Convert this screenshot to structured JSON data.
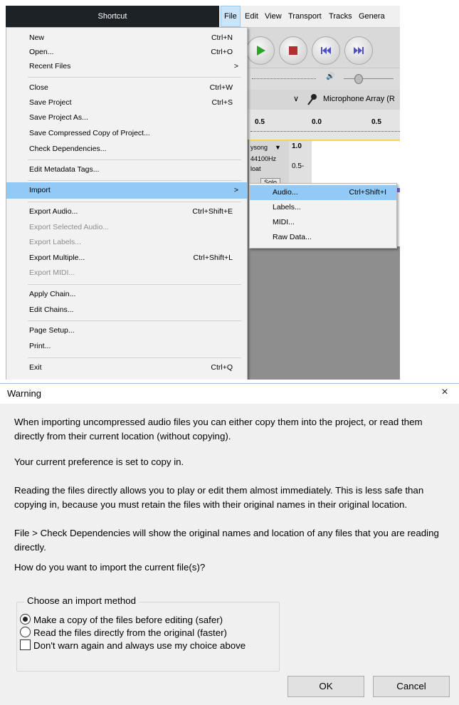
{
  "shortcut_bar": {
    "title": "Shortcut"
  },
  "menubar": {
    "items": [
      "File",
      "Edit",
      "View",
      "Transport",
      "Tracks",
      "Genera"
    ]
  },
  "devices": {
    "input_device": "Microphone Array (R"
  },
  "ruler": {
    "ticks": [
      "0.5",
      "0.0",
      "0.5"
    ]
  },
  "track": {
    "name": "ysong",
    "rate": "44100Hz",
    "format": "loat",
    "solo": "Solo",
    "scale_top": "1.0",
    "scale_mid": "0.5-"
  },
  "file_menu": {
    "items": [
      {
        "label": "New",
        "accel": "Ctrl+N"
      },
      {
        "label": "Open...",
        "accel": "Ctrl+O"
      },
      {
        "label": "Recent Files",
        "accel": ""
      },
      {
        "label": "Close",
        "accel": "Ctrl+W"
      },
      {
        "label": "Save Project",
        "accel": "Ctrl+S"
      },
      {
        "label": "Save Project As...",
        "accel": ""
      },
      {
        "label": "Save Compressed Copy of Project...",
        "accel": ""
      },
      {
        "label": "Check Dependencies...",
        "accel": ""
      },
      {
        "label": "Edit Metadata Tags...",
        "accel": ""
      },
      {
        "label": "Import",
        "accel": ""
      },
      {
        "label": "Export Audio...",
        "accel": "Ctrl+Shift+E"
      },
      {
        "label": "Export Selected Audio...",
        "accel": ""
      },
      {
        "label": "Export Labels...",
        "accel": ""
      },
      {
        "label": "Export Multiple...",
        "accel": "Ctrl+Shift+L"
      },
      {
        "label": "Export MIDI...",
        "accel": ""
      },
      {
        "label": "Apply Chain...",
        "accel": ""
      },
      {
        "label": "Edit Chains...",
        "accel": ""
      },
      {
        "label": "Page Setup...",
        "accel": ""
      },
      {
        "label": "Print...",
        "accel": ""
      },
      {
        "label": "Exit",
        "accel": "Ctrl+Q"
      }
    ],
    "submenu_arrow": ">"
  },
  "import_submenu": {
    "items": [
      {
        "label": "Audio...",
        "accel": "Ctrl+Shift+I"
      },
      {
        "label": "Labels...",
        "accel": ""
      },
      {
        "label": "MIDI...",
        "accel": ""
      },
      {
        "label": "Raw Data...",
        "accel": ""
      }
    ]
  },
  "dialog": {
    "title": "Warning",
    "close_glyph": "×",
    "para1": "When importing uncompressed audio files you can either copy them into the project, or read them directly from their current location (without copying).",
    "para2": "Your current preference is set to copy in.",
    "para3": "Reading the files directly allows you to play or edit them almost immediately.  This is less safe than copying in, because you must retain the files with their original names in their original location.",
    "para4": "File > Check Dependencies will show the original names and location of any files that you are reading directly.",
    "para5": "How do you want to import the current file(s)?",
    "method_group_label": "Choose an import method",
    "option_copy": "Make a copy of the files before editing (safer)",
    "option_direct": "Read the files directly from the original (faster)",
    "option_dont_warn": "Don't warn again and always use my choice above",
    "ok_label": "OK",
    "cancel_label": "Cancel"
  }
}
